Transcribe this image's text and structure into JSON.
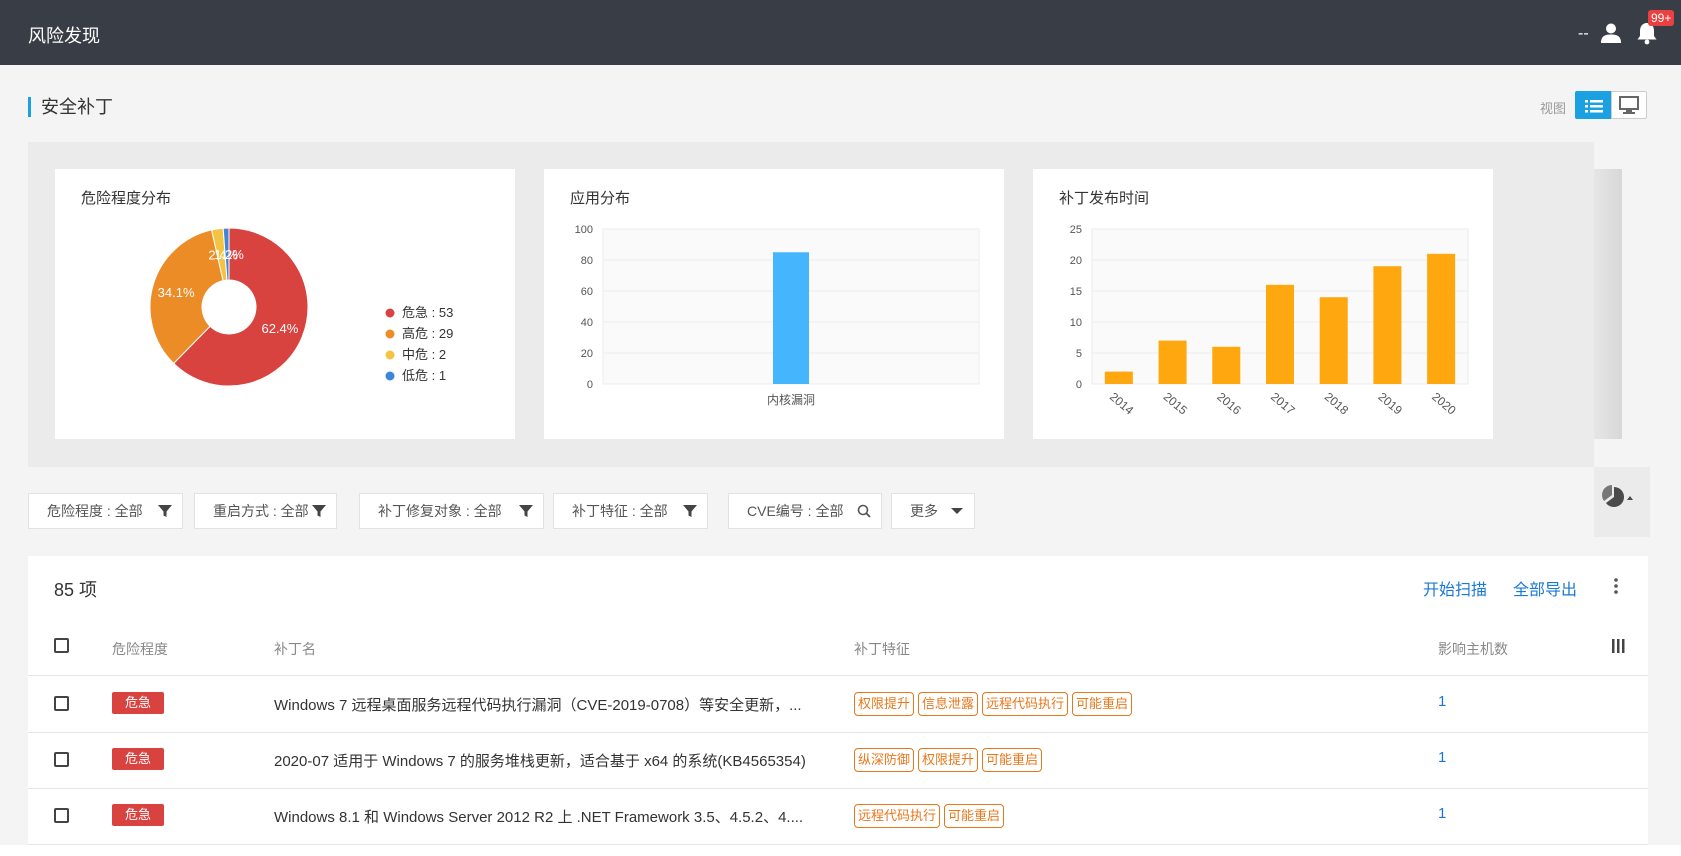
{
  "topbar": {
    "title": "风险发现",
    "user_dash": "--",
    "badge": "99+"
  },
  "section": {
    "title": "安全补丁",
    "view_label": "视图"
  },
  "charts": {
    "severity": {
      "title": "危险程度分布"
    },
    "app": {
      "title": "应用分布"
    },
    "release": {
      "title": "补丁发布时间"
    }
  },
  "chart_data": [
    {
      "type": "pie",
      "title": "危险程度分布",
      "slices": [
        {
          "name": "危急",
          "value": 53,
          "label": "62.4%",
          "legend": "危急 : 53",
          "color": "#d8423f"
        },
        {
          "name": "高危",
          "value": 29,
          "label": "34.1%",
          "legend": "高危 : 29",
          "color": "#ec8c27"
        },
        {
          "name": "中危",
          "value": 2,
          "label": "2.4%",
          "legend": "中危 : 2",
          "color": "#f3c341"
        },
        {
          "name": "低危",
          "value": 1,
          "label": "1.2%",
          "legend": "低危 : 1",
          "color": "#3e86d6"
        }
      ]
    },
    {
      "type": "bar",
      "title": "应用分布",
      "categories": [
        "内核漏洞"
      ],
      "values": [
        85
      ],
      "ylim": [
        0,
        100
      ],
      "yticks": [
        "0",
        "20",
        "40",
        "60",
        "80",
        "100"
      ],
      "color": "#45b6fe"
    },
    {
      "type": "bar",
      "title": "补丁发布时间",
      "categories": [
        "2014",
        "2015",
        "2016",
        "2017",
        "2018",
        "2019",
        "2020"
      ],
      "values": [
        2,
        7,
        6,
        16,
        14,
        19,
        21
      ],
      "ylim": [
        0,
        25
      ],
      "yticks": [
        "0",
        "5",
        "10",
        "15",
        "20",
        "25"
      ],
      "color": "#ffa70f"
    }
  ],
  "filters": [
    {
      "label": "危险程度 : 全部",
      "icon": "filter-icon"
    },
    {
      "label": "重启方式 : 全部",
      "icon": "filter-icon"
    },
    {
      "label": "补丁修复对象 : 全部",
      "icon": "filter-icon"
    },
    {
      "label": "补丁特征 : 全部",
      "icon": "filter-icon"
    },
    {
      "label": "CVE编号 : 全部",
      "icon": "search-icon"
    },
    {
      "label": "更多",
      "icon": "caret-down-icon"
    }
  ],
  "table": {
    "count": "85 项",
    "actions": {
      "scan": "开始扫描",
      "export": "全部导出"
    },
    "columns": {
      "severity": "危险程度",
      "name": "补丁名",
      "features": "补丁特征",
      "hosts": "影响主机数"
    },
    "rows": [
      {
        "severity": "危急",
        "name": "Windows 7 远程桌面服务远程代码执行漏洞（CVE-2019-0708）等安全更新，...",
        "tags": [
          "权限提升",
          "信息泄露",
          "远程代码执行",
          "可能重启"
        ],
        "hosts": "1"
      },
      {
        "severity": "危急",
        "name": "2020-07 适用于 Windows 7 的服务堆栈更新，适合基于 x64 的系统(KB4565354)",
        "tags": [
          "纵深防御",
          "权限提升",
          "可能重启"
        ],
        "hosts": "1"
      },
      {
        "severity": "危急",
        "name": "Windows 8.1 和 Windows Server 2012 R2 上 .NET Framework 3.5、4.5.2、4....",
        "tags": [
          "远程代码执行",
          "可能重启"
        ],
        "hosts": "1"
      }
    ]
  },
  "colors": {
    "accent": "#1ba1e2",
    "danger": "#d8423f",
    "tag": "#e8781b",
    "link": "#1a78d6"
  }
}
